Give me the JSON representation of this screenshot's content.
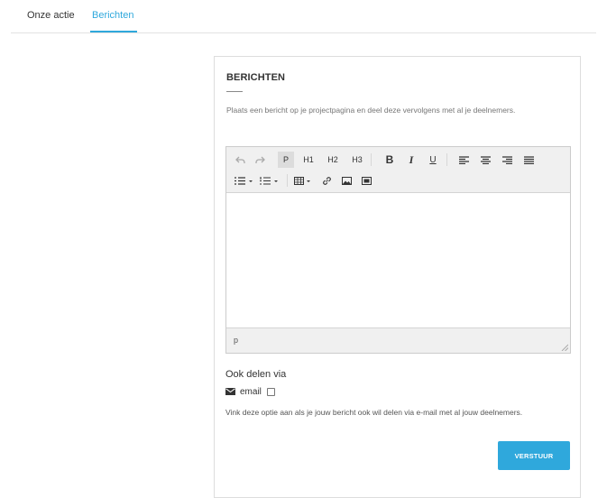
{
  "tabs": [
    {
      "label": "Onze actie"
    },
    {
      "label": "Berichten"
    }
  ],
  "colors": {
    "accent": "#2fa8dc"
  },
  "card": {
    "title": "BERICHTEN",
    "intro": "Plaats een bericht op je projectpagina en deel deze vervolgens met al je deelnemers."
  },
  "editor": {
    "toolbar": {
      "undo_icon": "undo-icon",
      "redo_icon": "redo-icon",
      "p_label": "P",
      "h1_label": "H1",
      "h2_label": "H2",
      "h3_label": "H3",
      "bold_label": "B",
      "italic_label": "I",
      "underline_label": "U",
      "align_icons": [
        "align-left-icon",
        "align-center-icon",
        "align-right-icon",
        "align-justify-icon"
      ],
      "list_icons": [
        "bullet-list-icon",
        "numbered-list-icon"
      ],
      "insert_icons": [
        "table-icon",
        "link-icon",
        "image-icon",
        "media-icon"
      ]
    },
    "path": "p"
  },
  "share": {
    "label": "Ook delen via",
    "email_label": "email",
    "email_checked": false,
    "hint": "Vink deze optie aan als je jouw bericht ook wil delen via e-mail met al jouw deelnemers."
  },
  "submit": {
    "label": "VERSTUUR"
  }
}
